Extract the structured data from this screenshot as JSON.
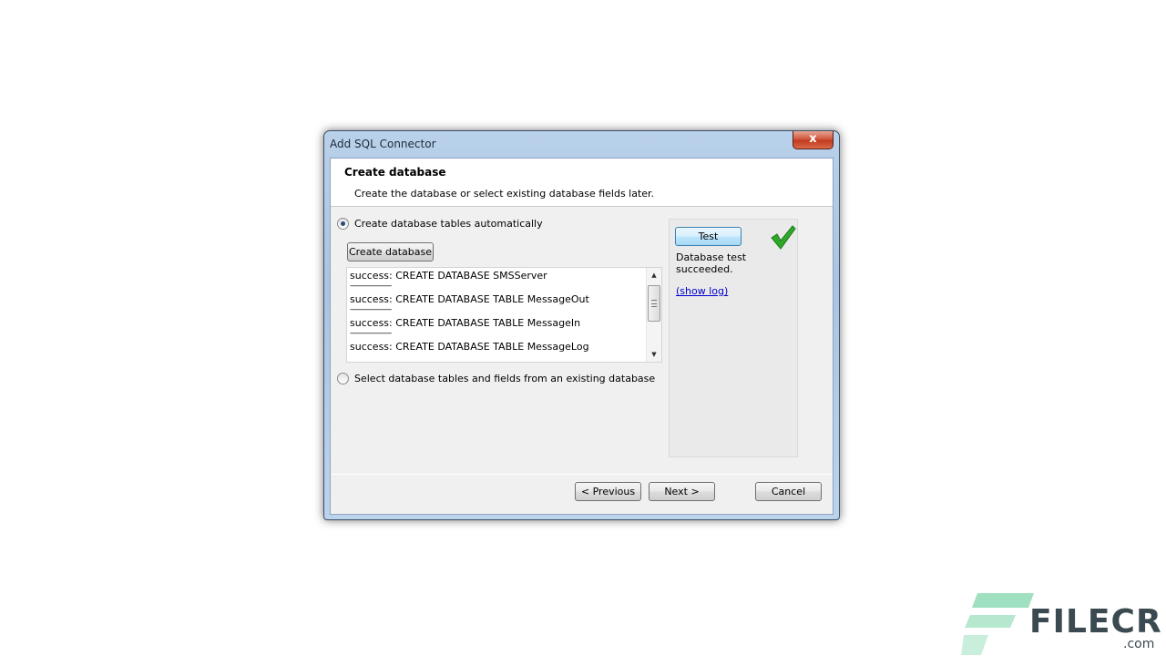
{
  "window": {
    "title": "Add SQL Connector",
    "close_glyph": "x"
  },
  "header": {
    "title": "Create database",
    "subtitle": "Create the database or select existing database fields later."
  },
  "options": {
    "auto_create_label": "Create database tables automatically",
    "auto_create_checked": true,
    "existing_label": "Select database tables and fields from an existing database",
    "existing_checked": false
  },
  "create_button_label": "Create database",
  "log": [
    "success: CREATE DATABASE SMSServer",
    "success: CREATE DATABASE TABLE MessageOut",
    "success: CREATE DATABASE TABLE MessageIn",
    "success: CREATE DATABASE TABLE MessageLog"
  ],
  "log_separator": "------------------------",
  "test_panel": {
    "button_label": "Test",
    "status_icon": "green-checkmark-icon",
    "status_line1": "Database test",
    "status_line2": "succeeded.",
    "link_label": "(show log)"
  },
  "footer": {
    "previous_label": "< Previous",
    "next_label": "Next >",
    "cancel_label": "Cancel"
  },
  "watermark": {
    "brand": "FILECR",
    "suffix": ".com"
  },
  "colors": {
    "accent_check": "#2fa82a",
    "link": "#0000cc",
    "watermark_green": "#9fe0c0"
  }
}
